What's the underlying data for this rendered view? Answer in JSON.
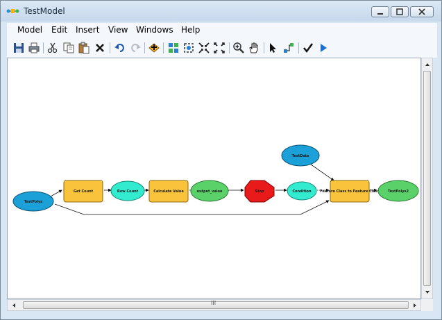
{
  "window": {
    "title": "TestModel"
  },
  "menu": [
    "Model",
    "Edit",
    "Insert",
    "View",
    "Windows",
    "Help"
  ],
  "toolbar": {
    "icons": [
      "save-icon",
      "print-icon",
      "cut-icon",
      "copy-icon",
      "paste-icon",
      "delete-icon",
      "undo-icon",
      "redo-icon",
      "add-data-icon",
      "auto-layout-icon",
      "full-extent-icon",
      "fixed-zoom-in-icon",
      "fixed-zoom-out-icon",
      "zoom-in-icon",
      "pan-icon",
      "select-icon",
      "connect-icon",
      "validate-icon",
      "run-icon"
    ]
  },
  "model": {
    "nodes": {
      "test_poly": "TestPolys",
      "get_count": "Get Count",
      "row_count": "Row Count",
      "calc_value": "Calculate Value",
      "output_value": "output_value",
      "stop": "Stop",
      "condition": "Condition",
      "fc_to_fc": "Feature Class to Feature Class",
      "test_data": "TestData",
      "test_poly2": "TestPolys2"
    }
  },
  "colors": {
    "tool": "#f9c33c",
    "variable": "#1ba0d8",
    "derived": "#33ecd0",
    "output": "#5bd16a",
    "stop": "#e81a1a"
  },
  "scrollbar": {
    "h_center": "III"
  }
}
